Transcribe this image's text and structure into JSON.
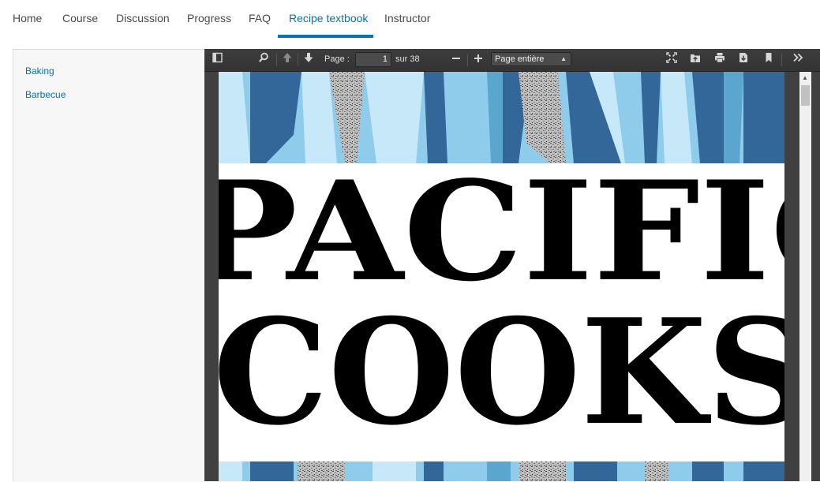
{
  "nav": {
    "tabs": [
      {
        "label": "Home"
      },
      {
        "label": "Course"
      },
      {
        "label": "Discussion"
      },
      {
        "label": "Progress"
      },
      {
        "label": "FAQ"
      },
      {
        "label": "Recipe textbook",
        "active": true
      },
      {
        "label": "Instructor"
      }
    ]
  },
  "sidebar": {
    "chapters": [
      {
        "label": "Baking"
      },
      {
        "label": "Barbecue"
      }
    ]
  },
  "viewer": {
    "toolbar": {
      "page_label": "Page :",
      "page_value": "1",
      "page_total": "sur 38",
      "zoom_value": "Page entière",
      "icons": [
        "sidebar-toggle-icon",
        "search-icon",
        "previous-page-icon",
        "next-page-icon",
        "zoom-out-icon",
        "zoom-in-icon",
        "presentation-mode-icon",
        "open-file-icon",
        "print-icon",
        "download-icon",
        "bookmark-icon",
        "tools-icon"
      ]
    },
    "document": {
      "title_line_1": "PACIFIC",
      "title_line_2": "COOKS"
    },
    "colors": {
      "accent": "#0075b4",
      "toolbar": "#383838",
      "cover_blue_dark": "#336699",
      "cover_blue_light": "#c6e8f8"
    }
  }
}
